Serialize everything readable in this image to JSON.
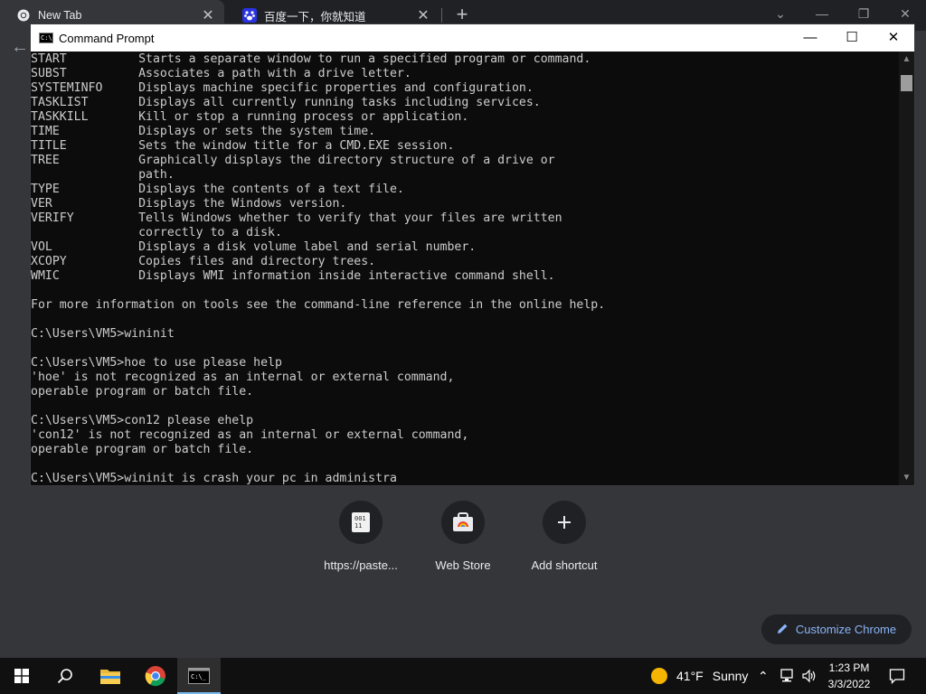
{
  "browser": {
    "tabs": [
      {
        "title": "New Tab",
        "active": true,
        "icon": "chrome-icon"
      },
      {
        "title": "百度一下，你就知道",
        "active": false,
        "icon": "baidu-paw-icon"
      }
    ]
  },
  "cmd": {
    "title": "Command Prompt",
    "lines": [
      "START          Starts a separate window to run a specified program or command.",
      "SUBST          Associates a path with a drive letter.",
      "SYSTEMINFO     Displays machine specific properties and configuration.",
      "TASKLIST       Displays all currently running tasks including services.",
      "TASKKILL       Kill or stop a running process or application.",
      "TIME           Displays or sets the system time.",
      "TITLE          Sets the window title for a CMD.EXE session.",
      "TREE           Graphically displays the directory structure of a drive or",
      "               path.",
      "TYPE           Displays the contents of a text file.",
      "VER            Displays the Windows version.",
      "VERIFY         Tells Windows whether to verify that your files are written",
      "               correctly to a disk.",
      "VOL            Displays a disk volume label and serial number.",
      "XCOPY          Copies files and directory trees.",
      "WMIC           Displays WMI information inside interactive command shell.",
      "",
      "For more information on tools see the command-line reference in the online help.",
      "",
      "C:\\Users\\VM5>wininit",
      "",
      "C:\\Users\\VM5>hoe to use please help",
      "'hoe' is not recognized as an internal or external command,",
      "operable program or batch file.",
      "",
      "C:\\Users\\VM5>con12 please ehelp",
      "'con12' is not recognized as an internal or external command,",
      "operable program or batch file.",
      "",
      "C:\\Users\\VM5>wininit is crash your pc in administra"
    ]
  },
  "newtab": {
    "shortcuts": [
      {
        "label": "https://paste...",
        "icon": "pastebin-icon"
      },
      {
        "label": "Web Store",
        "icon": "web-store-icon"
      },
      {
        "label": "Add shortcut",
        "icon": "plus-icon"
      }
    ],
    "customize_label": "Customize Chrome"
  },
  "taskbar": {
    "weather_temp": "41°F",
    "weather_cond": "Sunny",
    "time": "1:23 PM",
    "date": "3/3/2022"
  },
  "colors": {
    "cmd_background": "#0c0c0c",
    "cmd_text": "#cccccc",
    "chrome_dark": "#35363a",
    "accent_blue": "#8ab4f8"
  }
}
